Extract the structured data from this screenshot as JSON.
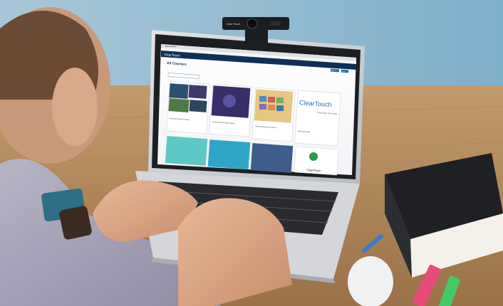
{
  "webcam": {
    "brand_label": "Clear Touch"
  },
  "browser": {
    "tab_title": "All Courses"
  },
  "site": {
    "logo_text": "ClearTouch",
    "page_title": "All Courses",
    "nav_items": [
      "All Courses",
      "Webinars",
      "Training & Certifications",
      "Resources",
      "Events",
      "Licensing"
    ],
    "login_label": "Sign In",
    "signup_label": "Join"
  },
  "courses": [
    {
      "title": "Command Center Essentials"
    },
    {
      "title": "Command Center Builder Basics"
    },
    {
      "title": "Galaxy Essentials for Teachers"
    },
    {
      "title": "Quick Start Guide",
      "card_logo": "ClearTouch",
      "card_subtitle": "Panel Quick Start Guide"
    }
  ],
  "bottom_cards": [
    {
      "label": "ClearTouch"
    }
  ],
  "colors": {
    "wall": "#8ab4c9",
    "desk": "#b08a5f",
    "brand_blue": "#1d6fb8",
    "laptop_silver": "#c8cacd"
  }
}
